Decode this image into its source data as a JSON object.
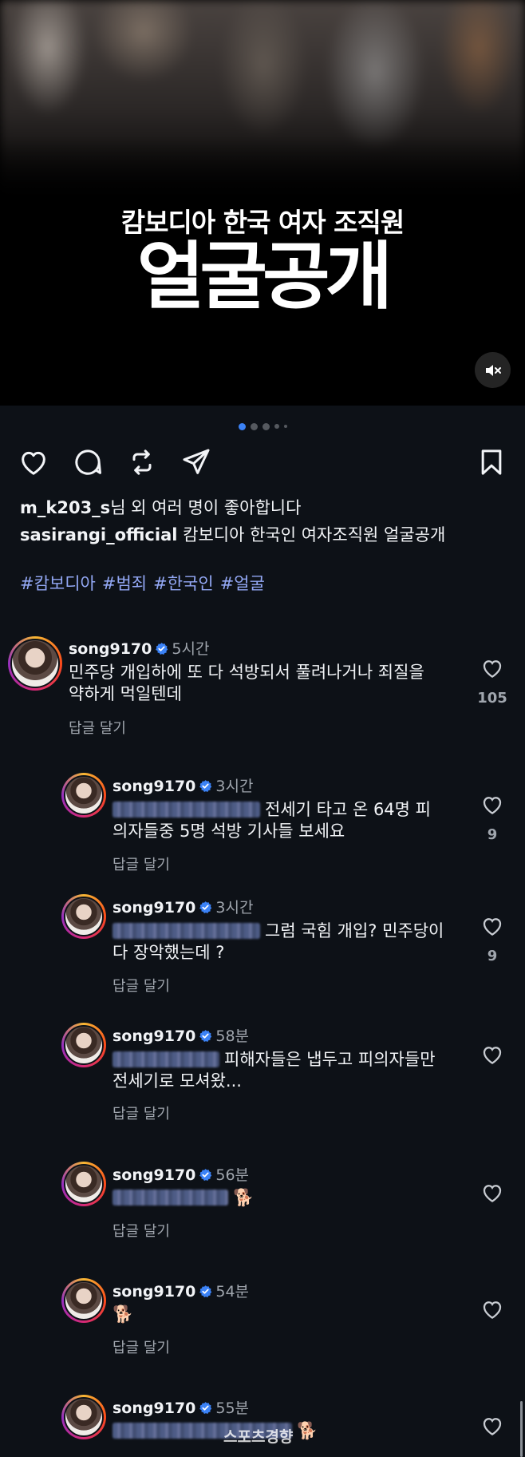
{
  "media": {
    "subtitle": "캄보디아 한국 여자 조직원",
    "title": "얼굴공개",
    "mute_icon": "speaker-muted-icon",
    "carousel": {
      "count": 5,
      "active_index": 0
    }
  },
  "actions": {
    "icons": [
      "heart-icon",
      "comment-icon",
      "repost-icon",
      "share-icon",
      "bookmark-icon"
    ]
  },
  "post": {
    "likes_user": "m_k203_s",
    "likes_suffix": "님 외 여러 명이 좋아합니다",
    "author": "sasirangi_official",
    "caption": "캄보디아 한국인 여자조직원 얼굴공개",
    "hashtags": [
      "#캄보디아",
      "#범죄",
      "#한국인",
      "#얼굴"
    ]
  },
  "comments": [
    {
      "user": "song9170",
      "time": "5시간",
      "line1": "민주당 개입하에 또 다 석방되서 풀려나거나 죄질을",
      "line2": "약하게 먹일텐데",
      "reply": "답글 달기",
      "likes": "105"
    },
    {
      "user": "song9170",
      "time": "3시간",
      "line1": "전세기 타고 온 64명 피",
      "line2": "의자들중 5명 석방 기사들 보세요",
      "reply": "답글 달기",
      "likes": "9"
    },
    {
      "user": "song9170",
      "time": "3시간",
      "line1": "그럼 국힘 개입? 민주당이",
      "line2": "다 장악했는데 ?",
      "reply": "답글 달기",
      "likes": "9"
    },
    {
      "user": "song9170",
      "time": "58분",
      "line1": "피해자들은 냅두고 피의자들만",
      "line2": "전세기로 모셔왔...",
      "reply": "답글 달기",
      "likes": ""
    },
    {
      "user": "song9170",
      "time": "56분",
      "line1": "🐕",
      "line2": "",
      "reply": "답글 달기",
      "likes": ""
    },
    {
      "user": "song9170",
      "time": "54분",
      "line1": "🐕",
      "line2": "",
      "reply": "답글 달기",
      "likes": ""
    },
    {
      "user": "song9170",
      "time": "55분",
      "line1": "🐕",
      "line2": "",
      "reply": "",
      "likes": ""
    }
  ],
  "watermark": "스포츠경향",
  "colors": {
    "background": "#0d1117",
    "hashtag": "#93a8f5",
    "verified": "#3b82f6",
    "carousel_active": "#3b82f6"
  }
}
